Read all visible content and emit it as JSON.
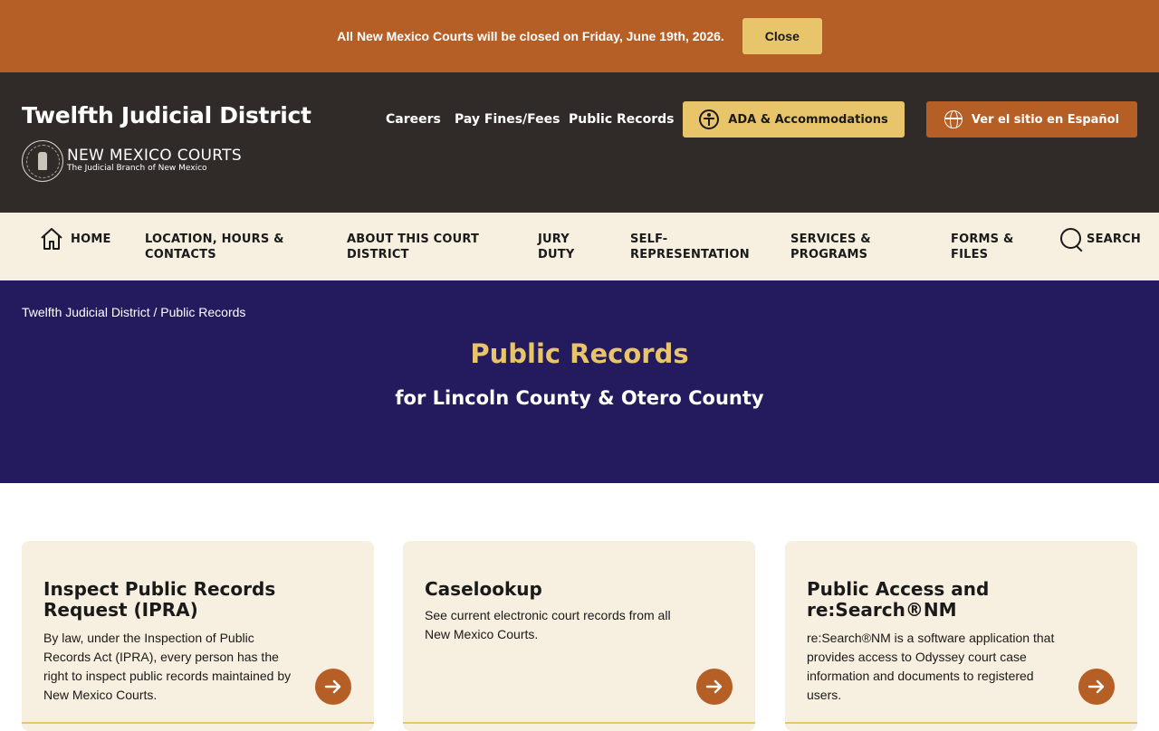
{
  "alert": {
    "message": "All New Mexico Courts will be closed on Friday, June 19th, 2026.",
    "close_label": "Close"
  },
  "header": {
    "site_title": "Twelfth Judicial District",
    "logo": {
      "name": "NEW MEXICO COURTS",
      "tagline": "The Judicial Branch of New Mexico"
    },
    "utility_links": {
      "careers": "Careers",
      "pay": "Pay Fines/Fees",
      "records": "Public Records"
    },
    "ada_label": "ADA & Accommodations",
    "spanish_label": "Ver el sitio en Español"
  },
  "nav": {
    "home": "HOME",
    "location": [
      "LOCATION, HOURS &",
      "CONTACTS"
    ],
    "about": [
      "ABOUT THIS COURT",
      "DISTRICT"
    ],
    "jury": [
      "JURY",
      "DUTY"
    ],
    "self_rep": [
      "SELF-",
      "REPRESENTATION"
    ],
    "services": [
      "SERVICES &",
      "PROGRAMS"
    ],
    "forms": [
      "FORMS &",
      "FILES"
    ],
    "search": "SEARCH"
  },
  "hero": {
    "breadcrumb": "Twelfth Judicial District / Public Records",
    "title": "Public Records",
    "subtitle": "for Lincoln County & Otero County"
  },
  "cards": [
    {
      "title_lines": [
        "Inspect Public Records",
        "Request (IPRA)"
      ],
      "desc_lines": [
        "By law, under the Inspection of Public",
        "Records Act (IPRA), every person has the",
        "right to inspect public records maintained by",
        "New Mexico Courts."
      ]
    },
    {
      "title_lines": [
        "Caselookup"
      ],
      "desc_lines": [
        "See current electronic court records from all",
        "New Mexico Courts."
      ]
    },
    {
      "title_lines": [
        "Public Access and",
        "re:Search®NM"
      ],
      "desc_lines": [
        "re:Search®NM is a software application that",
        "provides access to Odyssey court case",
        "information and documents to registered",
        "users."
      ]
    }
  ],
  "colors": {
    "alert_bg": "#b55f27",
    "header_bg": "#302b28",
    "nav_bg": "#f7efdf",
    "hero_bg": "#241a5e",
    "gold": "#e8c46b",
    "rust": "#b55f27"
  }
}
